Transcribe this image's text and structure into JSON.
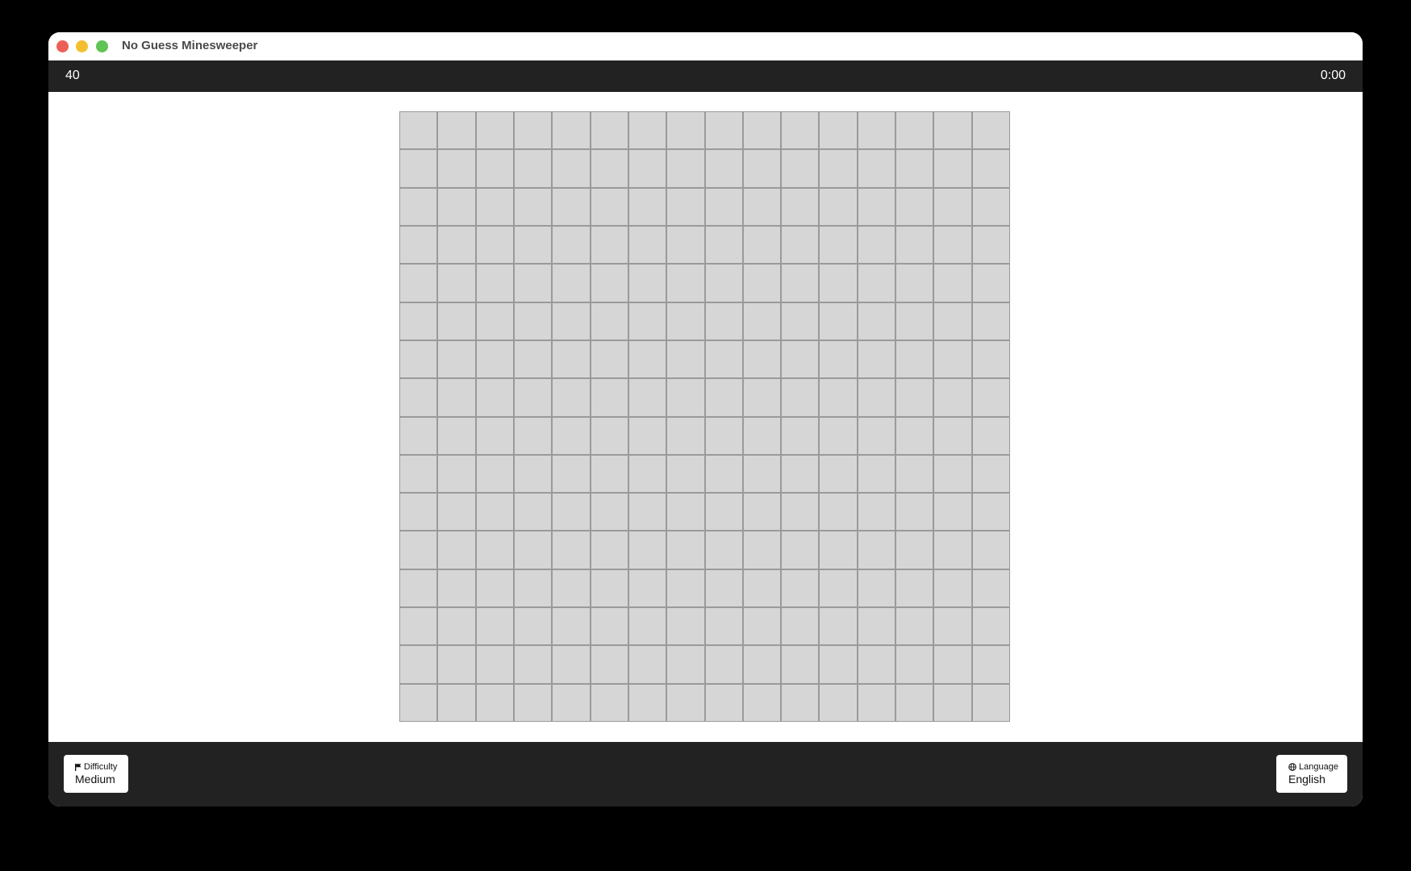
{
  "window": {
    "title": "No Guess Minesweeper",
    "controls": {
      "close_color": "#ec5f57",
      "minimize_color": "#f4bf2f",
      "maximize_color": "#5fc454"
    }
  },
  "status": {
    "mines_remaining": "40",
    "timer": "0:00"
  },
  "board": {
    "rows": 16,
    "cols": 16,
    "cell_state": "covered",
    "cell_color": "#d6d6d6",
    "grid_color": "#9a9a9a"
  },
  "footer": {
    "difficulty": {
      "label": "Difficulty",
      "icon": "flag-icon",
      "value": "Medium"
    },
    "language": {
      "label": "Language",
      "icon": "globe-icon",
      "value": "English"
    }
  },
  "colors": {
    "bar_background": "#222222",
    "page_background": "#000000"
  }
}
